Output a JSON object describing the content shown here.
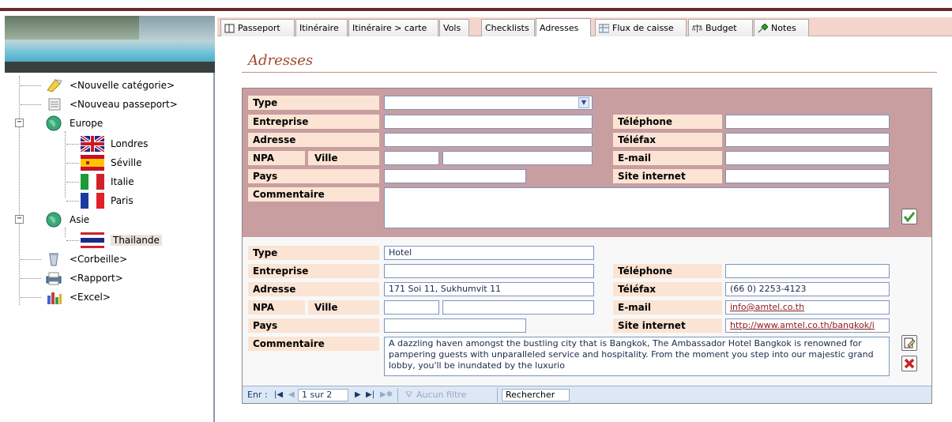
{
  "tree": {
    "items": [
      {
        "label": "<Nouvelle catégorie>",
        "icon": "new-category-icon"
      },
      {
        "label": "<Nouveau passeport>",
        "icon": "new-passport-icon"
      },
      {
        "label": "Europe",
        "icon": "globe-icon"
      },
      {
        "label": "Londres",
        "icon": "uk-flag-icon"
      },
      {
        "label": "Séville",
        "icon": "spain-flag-icon"
      },
      {
        "label": "Italie",
        "icon": "italy-flag-icon"
      },
      {
        "label": "Paris",
        "icon": "france-flag-icon"
      },
      {
        "label": "Asie",
        "icon": "globe-icon"
      },
      {
        "label": "Thailande",
        "icon": "thailand-flag-icon"
      },
      {
        "label": "<Corbeille>",
        "icon": "recycle-bin-icon"
      },
      {
        "label": "<Rapport>",
        "icon": "printer-icon"
      },
      {
        "label": "<Excel>",
        "icon": "excel-chart-icon"
      }
    ]
  },
  "tabs": [
    {
      "label": "Passeport",
      "icon": "passport-icon"
    },
    {
      "label": "Itinéraire"
    },
    {
      "label": "Itinéraire > carte"
    },
    {
      "label": "Vols"
    },
    {
      "label": "Checklists"
    },
    {
      "label": "Adresses",
      "active": true
    },
    {
      "label": "Flux de caisse",
      "icon": "cashflow-icon"
    },
    {
      "label": "Budget",
      "icon": "scale-icon"
    },
    {
      "label": "Notes",
      "icon": "pin-icon"
    }
  ],
  "heading": "Adresses",
  "labels": {
    "type": "Type",
    "entreprise": "Entreprise",
    "adresse": "Adresse",
    "npa": "NPA",
    "ville": "Ville",
    "pays": "Pays",
    "commentaire": "Commentaire",
    "telephone": "Téléphone",
    "telefax": "Téléfax",
    "email": "E-mail",
    "site": "Site internet"
  },
  "new_record": {
    "type": "",
    "entreprise": "",
    "adresse": "",
    "npa": "",
    "ville": "",
    "pays": "",
    "commentaire": "",
    "telephone": "",
    "telefax": "",
    "email": "",
    "site": ""
  },
  "record": {
    "type": "Hotel",
    "entreprise": "",
    "adresse": "171 Soi 11, Sukhumvit 11",
    "npa": "",
    "ville": "",
    "pays": "",
    "commentaire": "A dazzling haven amongst the bustling city that is Bangkok, The Ambassador Hotel Bangkok is renowned for pampering guests with unparalleled service and hospitality. From the moment you step into our majestic grand lobby, you'll be inundated by the luxurio",
    "telephone": "",
    "telefax": "(66 0) 2253-4123",
    "email": "info@amtel.co.th",
    "site": "http://www.amtel.co.th/bangkok/i"
  },
  "navigation": {
    "label": "Enr :",
    "position": "1 sur 2",
    "filter": "Aucun filtre",
    "search": "Rechercher"
  },
  "colors": {
    "accent": "#a0482a",
    "new_record_bg": "#c99ea0",
    "label_bg": "#fbe4d4",
    "tabbar_bg": "#f4d4cc"
  }
}
